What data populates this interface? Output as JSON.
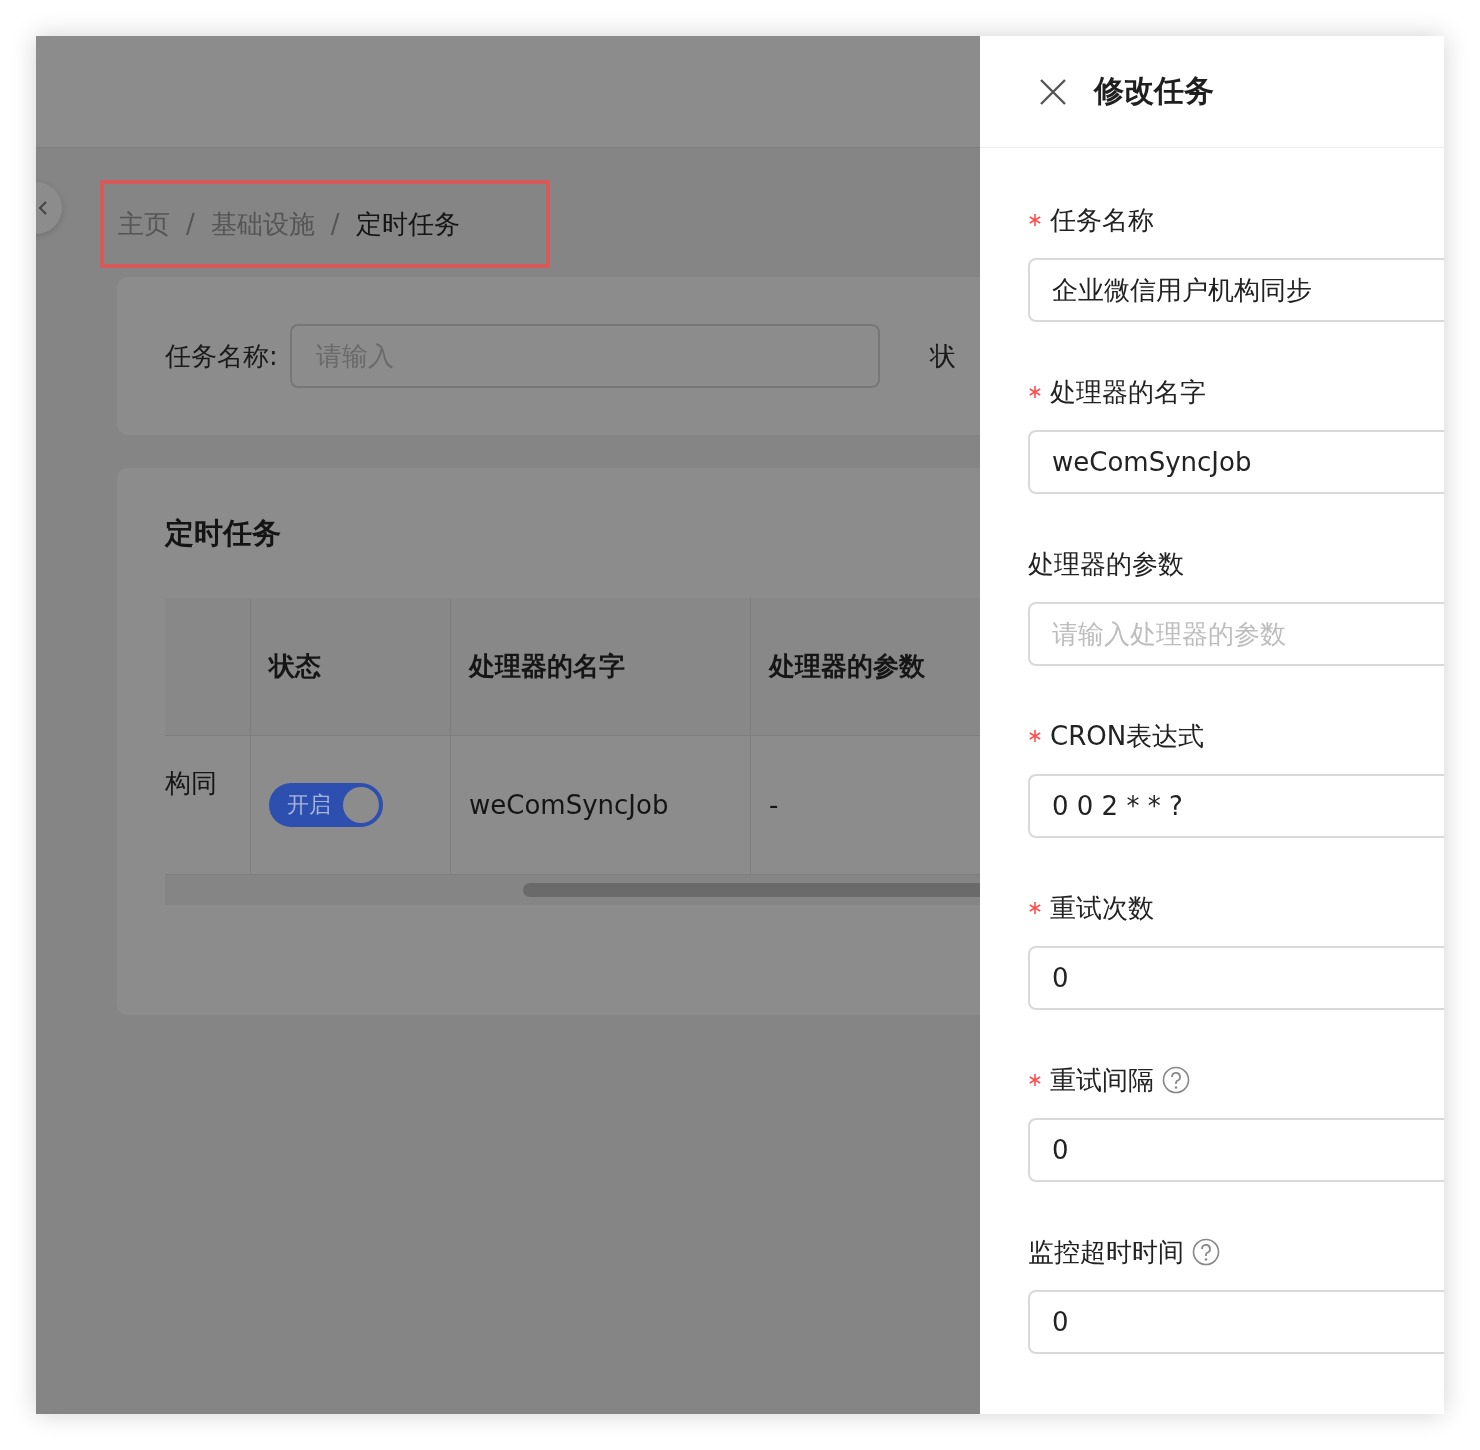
{
  "breadcrumb": [
    {
      "label": "主页",
      "current": false
    },
    {
      "separator": "/",
      "label": "基础设施",
      "current": false
    },
    {
      "separator": "/",
      "label": "定时任务",
      "current": true
    }
  ],
  "search_form": {
    "label": "任务名称:",
    "placeholder": "请输入",
    "next_label": "状"
  },
  "table_card": {
    "title": "定时任务",
    "columns": [
      "状态",
      "处理器的名字",
      "处理器的参数"
    ],
    "rows": [
      {
        "column_1": "构同",
        "status": {
          "label": "开启",
          "on": true
        },
        "handler": "weComSyncJob",
        "params": "-"
      }
    ]
  },
  "drawer": {
    "title": "修改任务",
    "fields": [
      {
        "label": "任务名称",
        "required": true,
        "help": false,
        "value": "企业微信用户机构同步"
      },
      {
        "label": "处理器的名字",
        "required": true,
        "help": false,
        "value": "weComSyncJob"
      },
      {
        "label": "处理器的参数",
        "required": false,
        "help": false,
        "placeholder": "请输入处理器的参数"
      },
      {
        "label": "CRON表达式",
        "required": true,
        "help": false,
        "value": "0 0 2 * * ?"
      },
      {
        "label": "重试次数",
        "required": true,
        "help": false,
        "value": "0"
      },
      {
        "label": "重试间隔",
        "required": true,
        "help": true,
        "value": "0"
      },
      {
        "label": "监控超时时间",
        "required": false,
        "help": true,
        "value": "0"
      }
    ]
  }
}
